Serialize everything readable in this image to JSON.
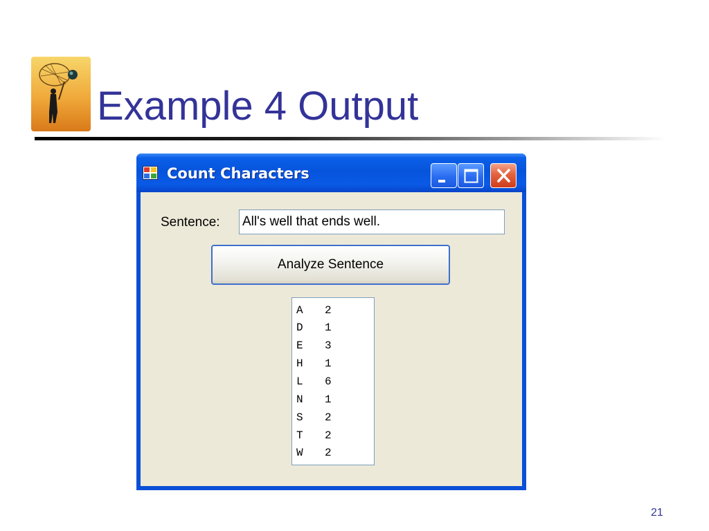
{
  "slide": {
    "title": "Example 4 Output",
    "number": "21",
    "logo_icon": "person-with-net-clipart"
  },
  "window": {
    "title": "Count Characters",
    "app_icon": "windows-form-icon",
    "controls": {
      "minimize_icon": "minimize-icon",
      "maximize_icon": "maximize-icon",
      "close_icon": "close-icon"
    }
  },
  "form": {
    "sentence_label": "Sentence:",
    "sentence_value": "All's well that ends well.",
    "analyze_button": "Analyze Sentence"
  },
  "results": [
    {
      "letter": "A",
      "count": "2"
    },
    {
      "letter": "D",
      "count": "1"
    },
    {
      "letter": "E",
      "count": "3"
    },
    {
      "letter": "H",
      "count": "1"
    },
    {
      "letter": "L",
      "count": "6"
    },
    {
      "letter": "N",
      "count": "1"
    },
    {
      "letter": "S",
      "count": "2"
    },
    {
      "letter": "T",
      "count": "2"
    },
    {
      "letter": "W",
      "count": "2"
    }
  ],
  "colors": {
    "title_text": "#333399",
    "titlebar_blue": "#0754dc",
    "client_background": "#ece9d8",
    "close_button": "#e4623e"
  }
}
